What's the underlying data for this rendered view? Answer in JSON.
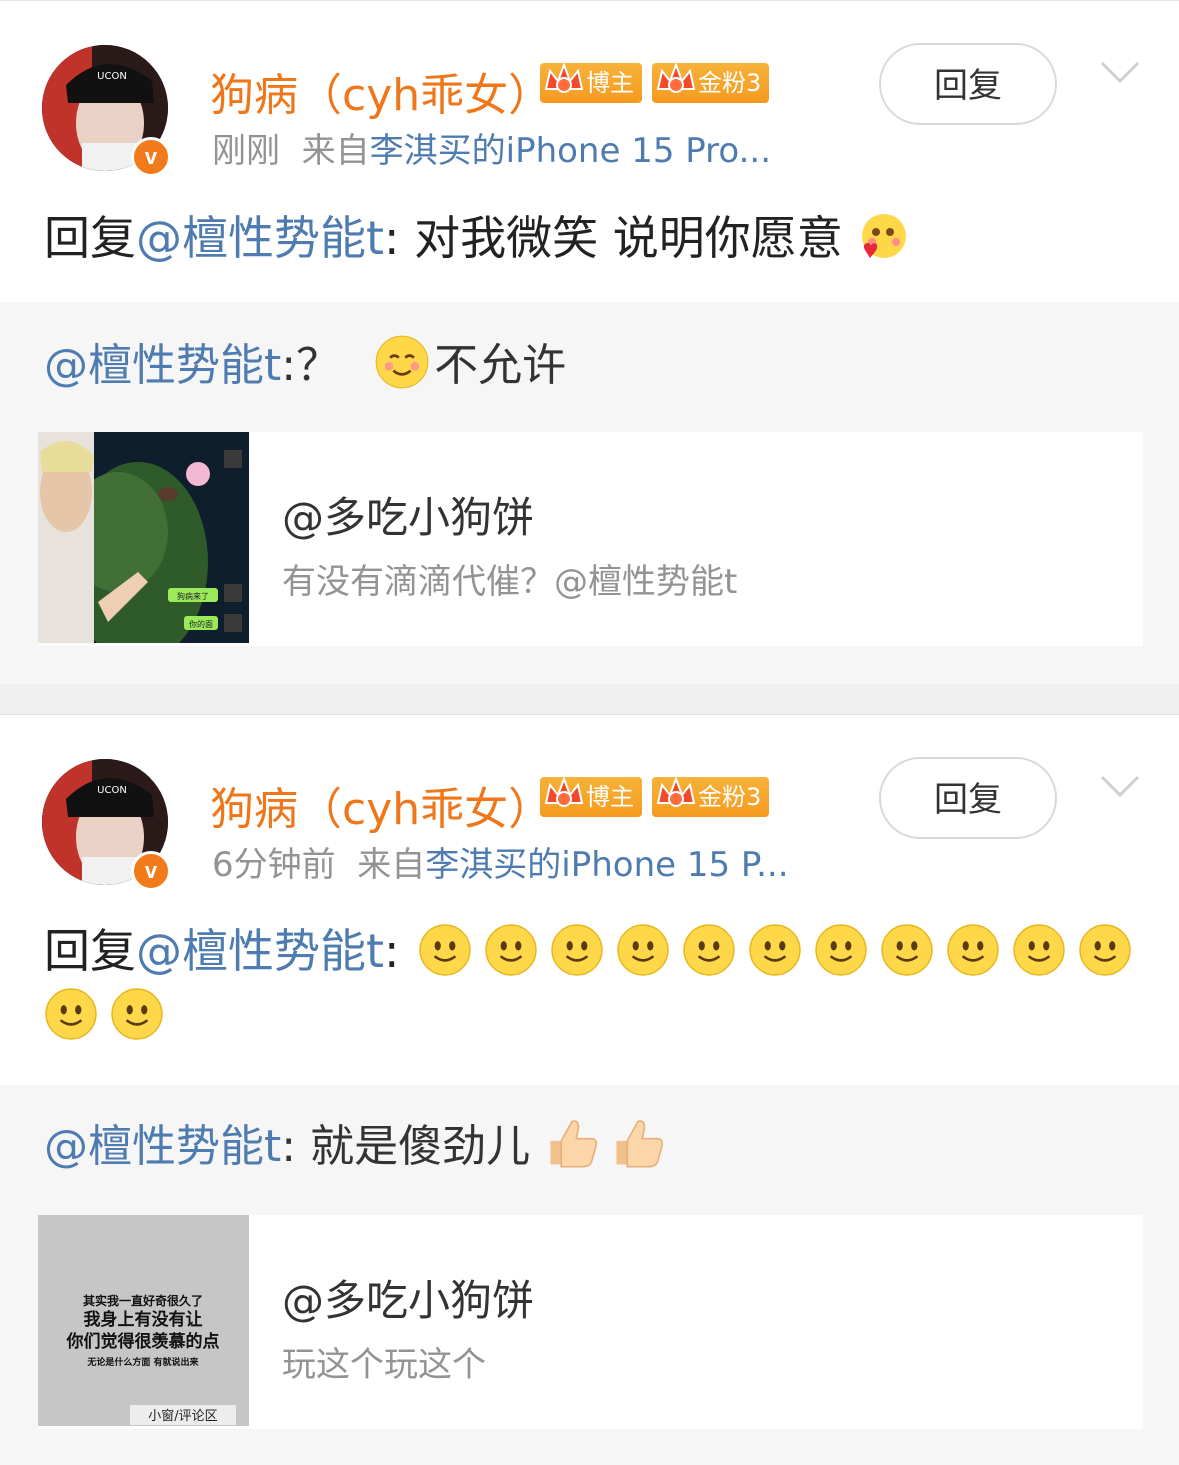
{
  "posts": [
    {
      "username": "狗病（cyh乖女）",
      "badge_blogger": "博主",
      "badge_fan": "金粉3",
      "time": "刚刚",
      "source_prefix": "来自",
      "source": "李淇买的iPhone 15 Pro...",
      "reply_label": "回复",
      "body_prefix": "回复",
      "body_mention": "@檀性势能t",
      "body_text": ": 对我微笑 说明你愿意",
      "body_emoji": [
        "blush-heart-emoji"
      ],
      "quote_mention": "@檀性势能t",
      "quote_text": ":？",
      "quote_suffix": "不允许",
      "card_name": "@多吃小狗饼",
      "card_desc": "有没有滴滴代催？@檀性势能t"
    },
    {
      "username": "狗病（cyh乖女）",
      "badge_blogger": "博主",
      "badge_fan": "金粉3",
      "time": "6分钟前",
      "source_prefix": "来自",
      "source": "李淇买的iPhone 15 P...",
      "reply_label": "回复",
      "body_prefix": "回复",
      "body_mention": "@檀性势能t",
      "body_text": ":",
      "smile_count": 13,
      "quote_mention": "@檀性势能t",
      "quote_text": ": 就是傻劲儿",
      "card_name": "@多吃小狗饼",
      "card_desc": "玩这个玩这个",
      "thumb_text": [
        "其实我一直好奇很久了",
        "我身上有没有让",
        "你们觉得很羡慕的点",
        "无论是什么方面 有就说出来"
      ],
      "thumb_caption": "小窗/评论区",
      "thumb1_bubbles": [
        "狗病来了",
        "你的面"
      ]
    }
  ],
  "colors": {
    "username": "#f0761a",
    "mention": "#4f7cb0",
    "meta": "#939393",
    "quote_bg": "#f6f6f6"
  }
}
